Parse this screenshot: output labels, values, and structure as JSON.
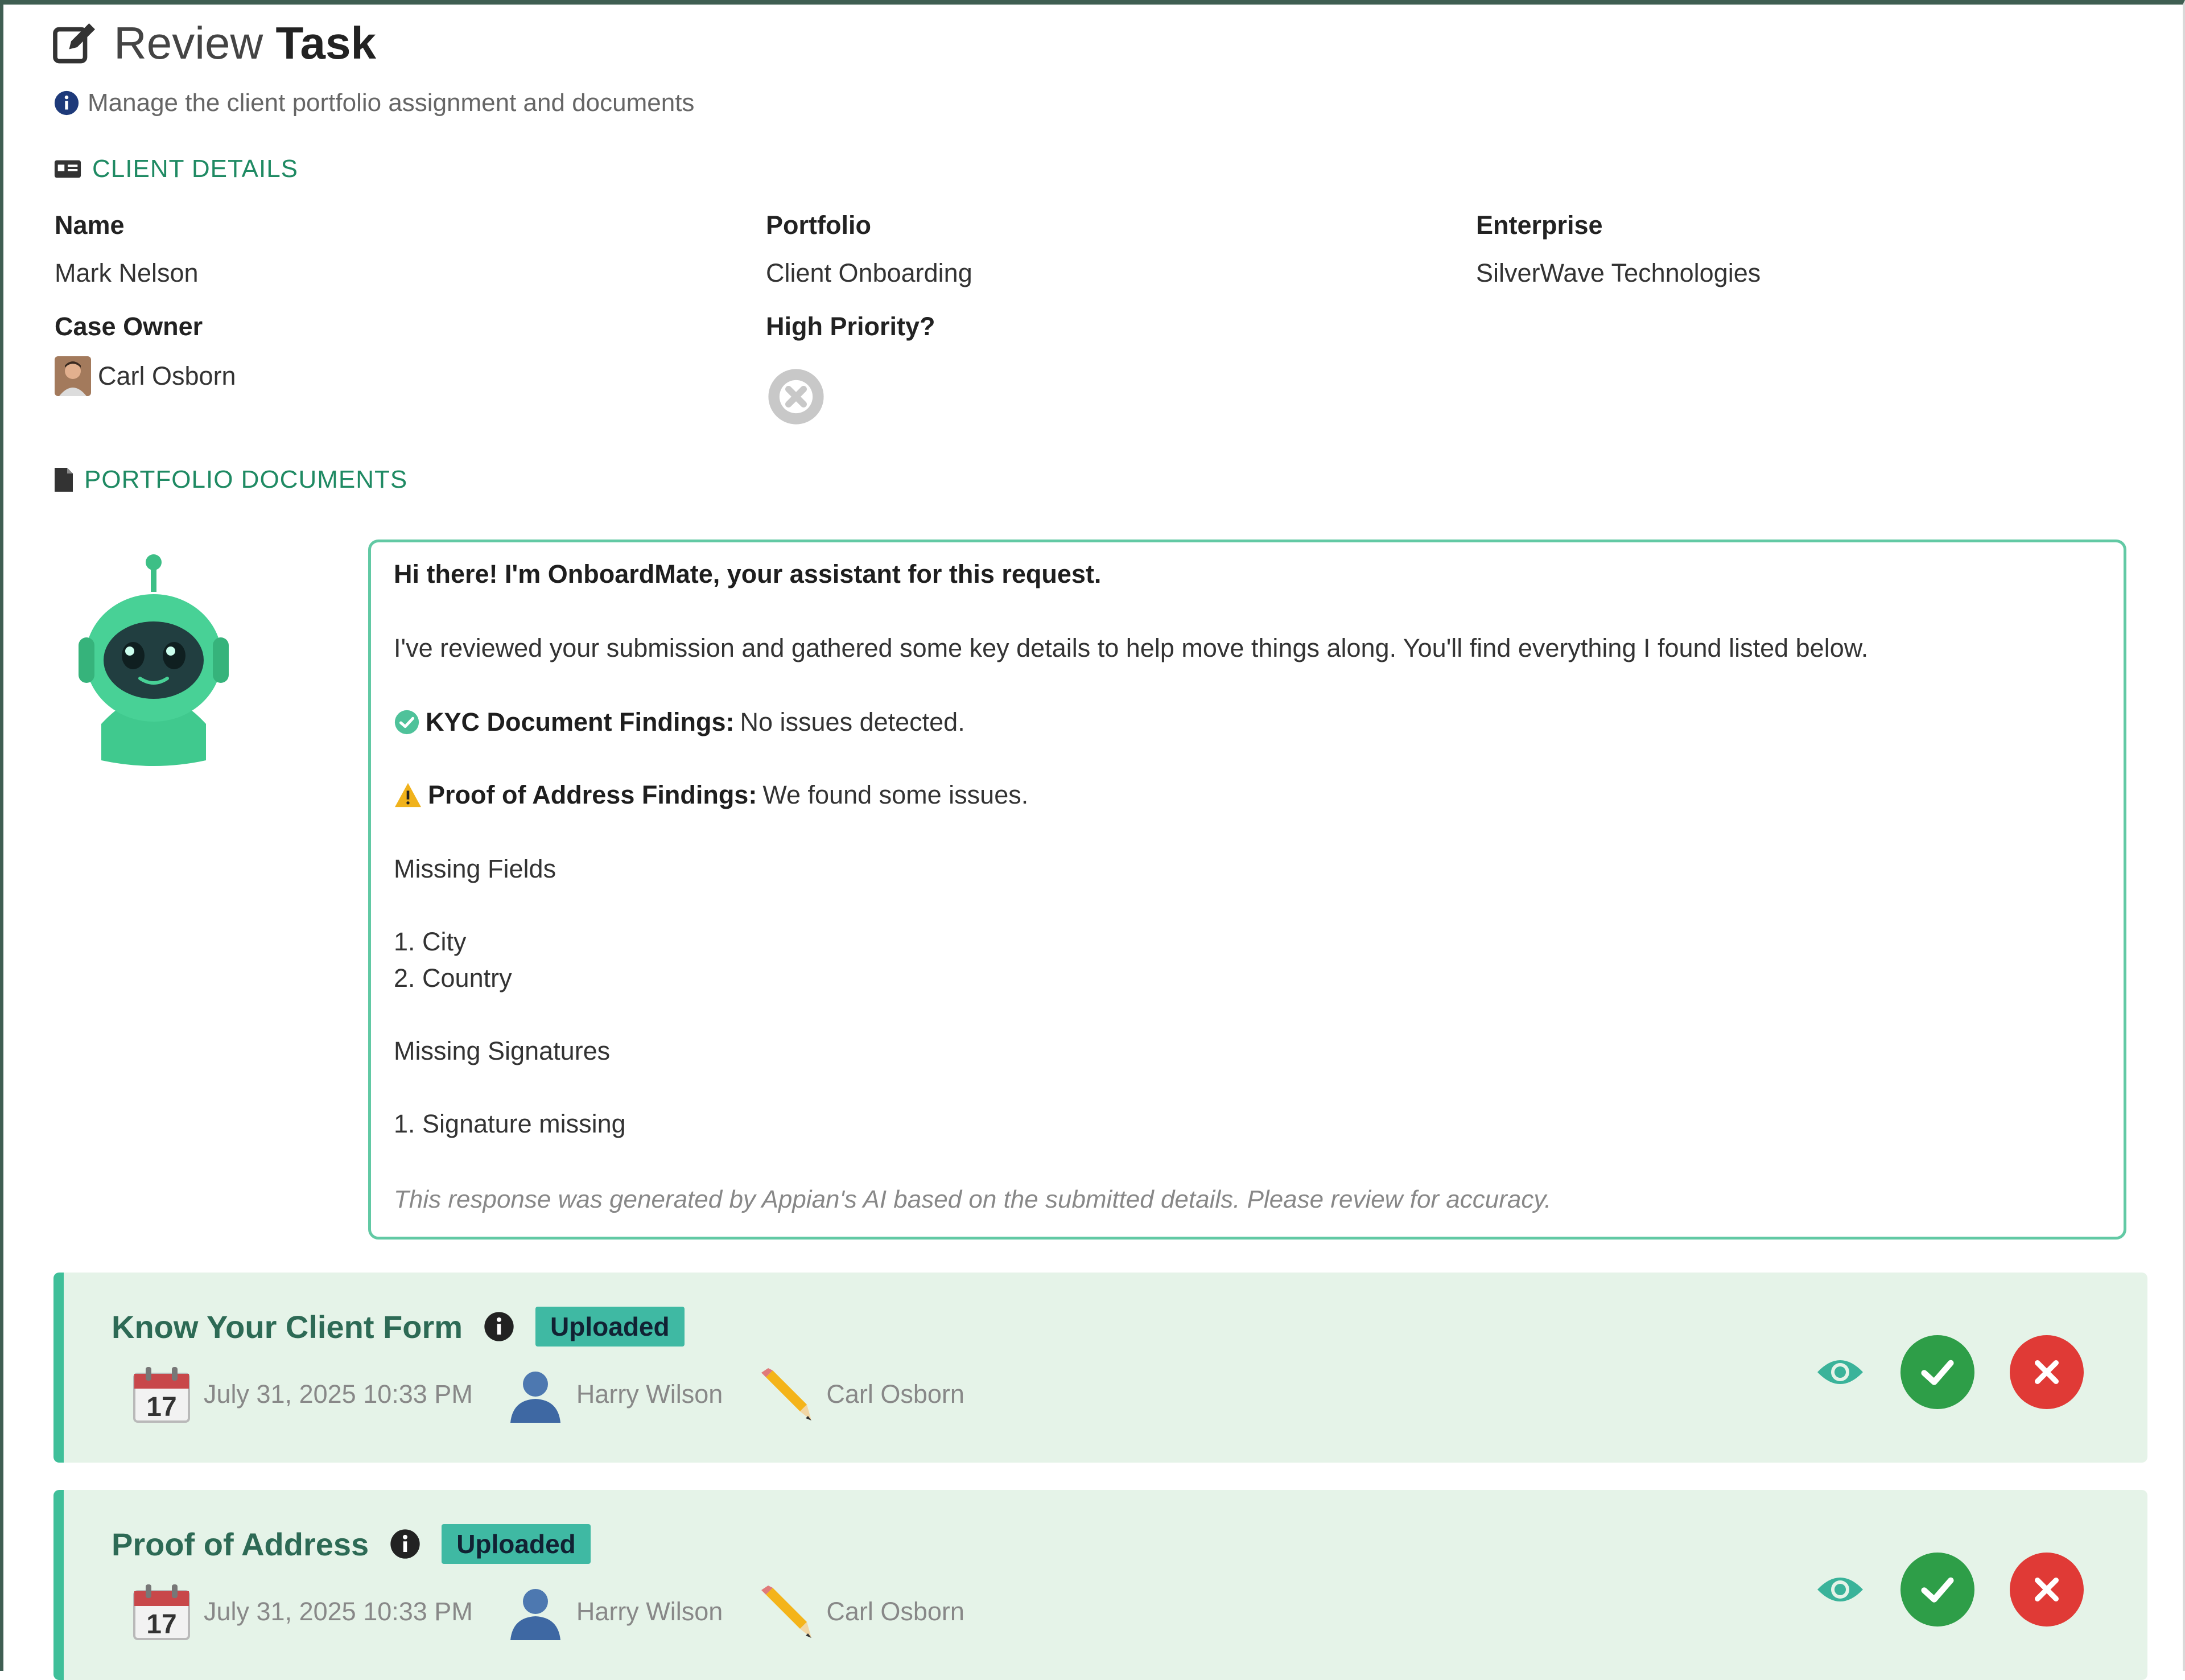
{
  "header": {
    "title_prefix": "Review",
    "title_bold": "Task"
  },
  "subtitle": "Manage the client portfolio assignment and documents",
  "client_details": {
    "section_title": "CLIENT DETAILS",
    "name_label": "Name",
    "name_value": "Mark Nelson",
    "portfolio_label": "Portfolio",
    "portfolio_value": "Client Onboarding",
    "enterprise_label": "Enterprise",
    "enterprise_value": "SilverWave Technologies",
    "case_owner_label": "Case Owner",
    "case_owner_value": "Carl Osborn",
    "high_priority_label": "High Priority?"
  },
  "portfolio_documents": {
    "section_title": "PORTFOLIO DOCUMENTS",
    "assistant": {
      "greeting": "Hi there! I'm OnboardMate, your assistant for this request.",
      "intro": "I've reviewed your submission and gathered some key details to help move things along. You'll find everything I found listed below.",
      "kyc_label": "KYC Document Findings:",
      "kyc_text": "No issues detected.",
      "poa_label": "Proof of Address Findings:",
      "poa_text": "We found some issues.",
      "missing_fields_title": "Missing Fields",
      "missing_fields": [
        "1. City",
        "2. Country"
      ],
      "missing_signatures_title": "Missing Signatures",
      "missing_signatures": [
        "1. Signature missing"
      ],
      "footnote": "This response was generated by Appian's AI based on the submitted details. Please review for accuracy."
    },
    "documents": [
      {
        "name": "Know Your Client Form",
        "status": "Uploaded",
        "calendar_day": "17",
        "date": "July 31, 2025 10:33 PM",
        "uploaded_by": "Harry Wilson",
        "edited_by": "Carl Osborn"
      },
      {
        "name": "Proof of Address",
        "status": "Uploaded",
        "calendar_day": "17",
        "date": "July 31, 2025 10:33 PM",
        "uploaded_by": "Harry Wilson",
        "edited_by": "Carl Osborn"
      }
    ]
  },
  "colors": {
    "accent": "#1f8a63",
    "card_bg": "#e5f3e8",
    "card_border": "#3fbf99",
    "approve": "#2e9e48",
    "reject": "#e03a36",
    "status_badge": "#3fb9a3"
  }
}
